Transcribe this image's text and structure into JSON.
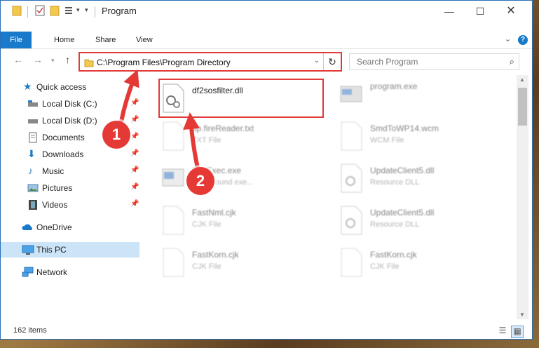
{
  "window": {
    "title": "Program"
  },
  "ribbon": {
    "tabs": [
      "File",
      "Home",
      "Share",
      "View"
    ]
  },
  "address": {
    "path": "C:\\Program Files\\Program Directory"
  },
  "search": {
    "placeholder": "Search Program"
  },
  "nav": {
    "quick_access": "Quick access",
    "items": [
      "Local Disk (C:)",
      "Local Disk (D:)",
      "Documents",
      "Downloads",
      "Music",
      "Pictures",
      "Videos"
    ],
    "onedrive": "OneDrive",
    "this_pc": "This PC",
    "network": "Network"
  },
  "files": [
    {
      "name": "df2sosfilter.dll",
      "type": ""
    },
    {
      "name": "program.exe",
      "type": ""
    },
    {
      "name": "ttp.fireReader.txt",
      "type": "TXT File"
    },
    {
      "name": "SmdToWP14.wcm",
      "type": "WCM File"
    },
    {
      "name": "PxeExec.exe",
      "type": "background exe..."
    },
    {
      "name": "UpdateClient5.dll",
      "type": "Resource DLL"
    },
    {
      "name": "FastNml.cjk",
      "type": "CJK File"
    },
    {
      "name": "UpdateClient5.dll",
      "type": "Resource DLL"
    },
    {
      "name": "FastKorn.cjk",
      "type": "CJK File"
    },
    {
      "name": "FastKorn.cjk",
      "type": "CJK File"
    }
  ],
  "markers": [
    "1",
    "2"
  ],
  "status": {
    "count": "162 items"
  },
  "colors": {
    "accent": "#1979ca",
    "annotation": "#e53935"
  }
}
